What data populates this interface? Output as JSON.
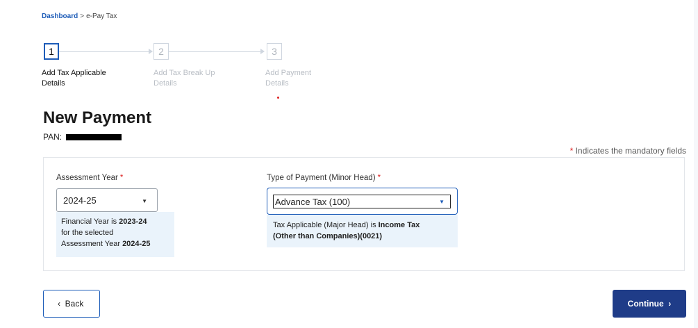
{
  "breadcrumb": {
    "home": "Dashboard",
    "separator": ">",
    "current": "e-Pay Tax"
  },
  "stepper": {
    "steps": [
      {
        "number": "1",
        "label_line1": "Add Tax Applicable",
        "label_line2": "Details",
        "state": "active"
      },
      {
        "number": "2",
        "label_line1": "Add Tax Break Up",
        "label_line2": "Details",
        "state": "inactive"
      },
      {
        "number": "3",
        "label_line1": "Add Payment",
        "label_line2": "Details",
        "state": "inactive"
      }
    ]
  },
  "page": {
    "title": "New Payment",
    "pan_label": "PAN:"
  },
  "mandatory_note": {
    "star": "*",
    "text": "Indicates the mandatory fields"
  },
  "assessment_year": {
    "label": "Assessment Year",
    "required_star": "*",
    "value": "2024-25",
    "info_prefix": "Financial Year is ",
    "info_fy": "2023-24",
    "info_mid1": "for the selected",
    "info_mid2": "Assessment Year ",
    "info_ay": "2024-25"
  },
  "payment_type": {
    "label": "Type of Payment (Minor Head)",
    "required_star": "*",
    "value": "Advance Tax (100)",
    "info_prefix": "Tax Applicable (Major Head) is ",
    "info_bold1": "Income Tax",
    "info_bold2": "(Other than Companies)(0021)"
  },
  "buttons": {
    "back": "Back",
    "continue": "Continue"
  },
  "colors": {
    "accent": "#1d5cb8",
    "primary_button": "#1f3c88",
    "info_bg": "#eaf3fb",
    "required": "#dd2222"
  }
}
